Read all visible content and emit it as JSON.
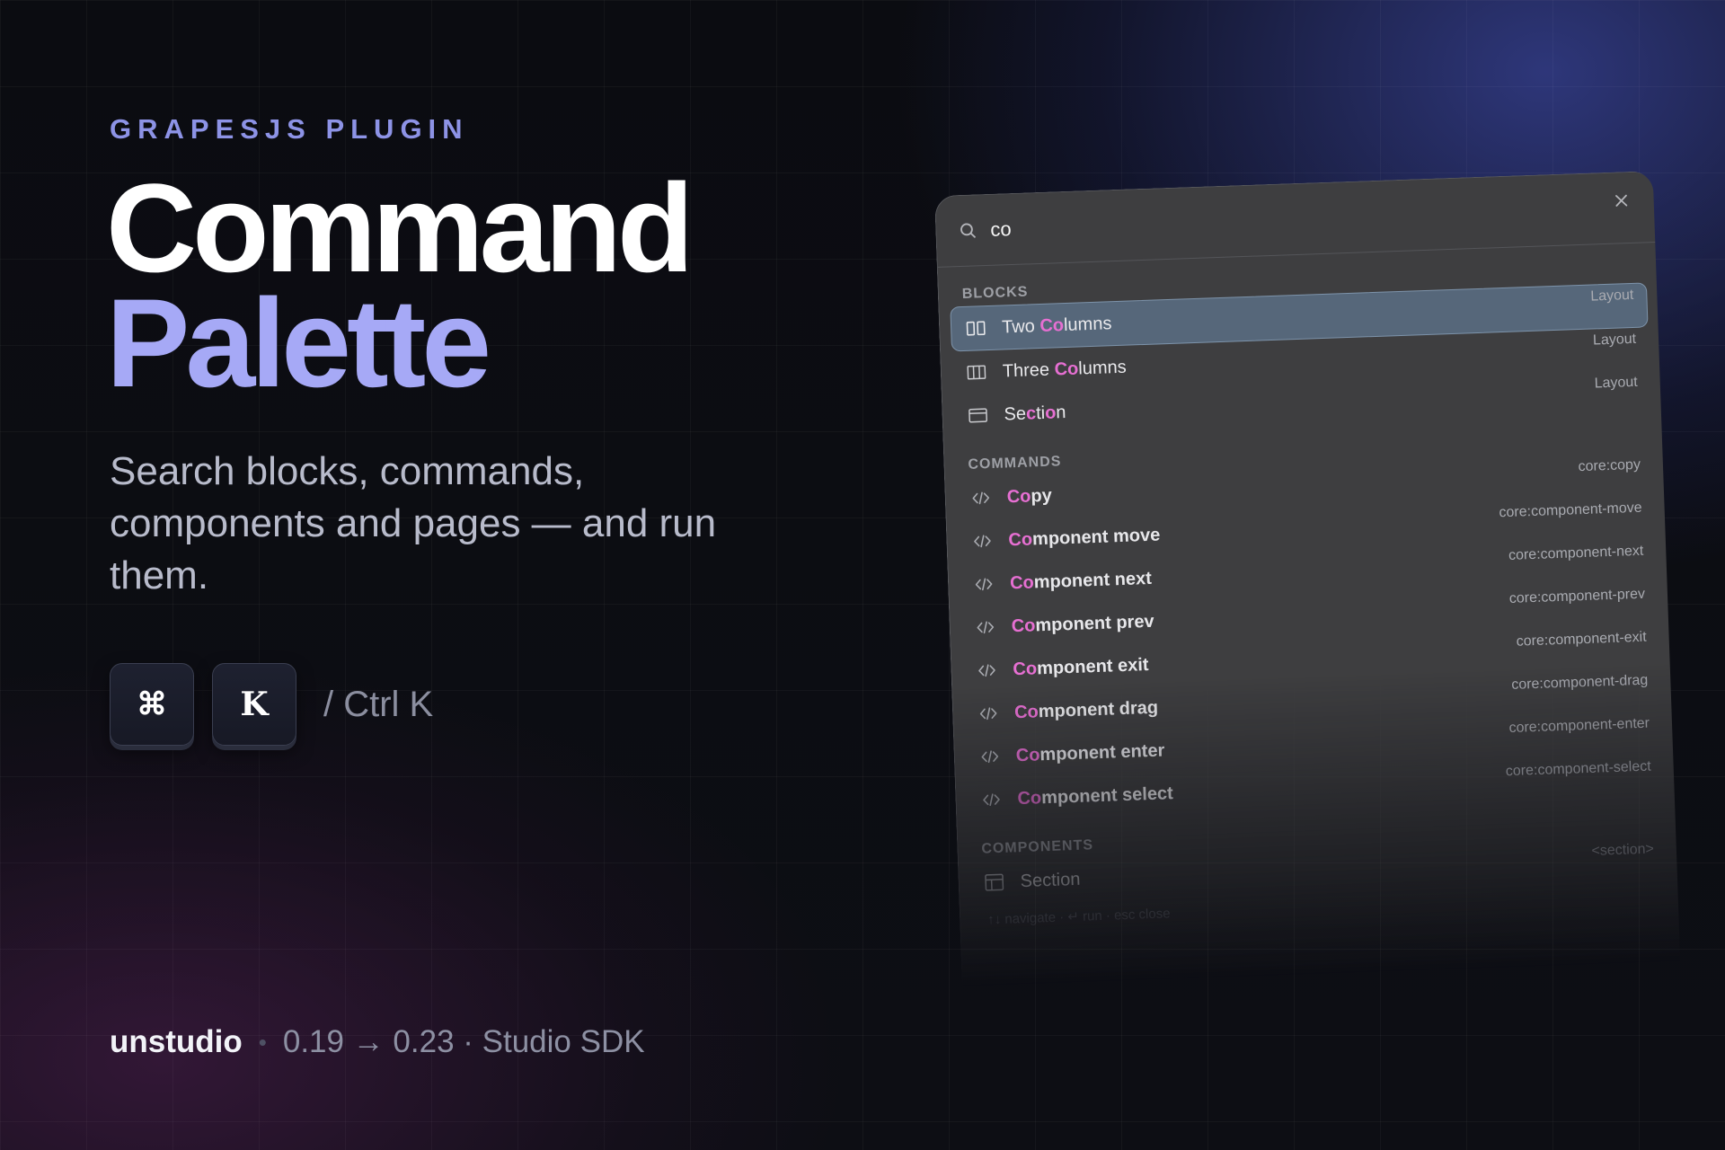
{
  "eyebrow": "GRAPESJS PLUGIN",
  "title": {
    "line1": "Command",
    "line2": "Palette"
  },
  "subtitle": "Search blocks, commands, components and pages — and run them.",
  "shortcut": {
    "key1": "⌘",
    "key2": "K",
    "alt": "/ Ctrl K"
  },
  "footer": {
    "brand": "unstudio",
    "separator": "•",
    "version": "0.19 → 0.23 · Studio SDK"
  },
  "palette": {
    "search_value": "co",
    "sections": {
      "blocks": "BLOCKS",
      "commands": "COMMANDS",
      "components": "COMPONENTS"
    },
    "blocks": [
      {
        "prefix": "Two ",
        "match": "Co",
        "rest": "lumns",
        "tag": "Layout",
        "icon": "two-columns-icon"
      },
      {
        "prefix": "Three ",
        "match": "Co",
        "rest": "lumns",
        "tag": "Layout",
        "icon": "three-columns-icon"
      },
      {
        "prefix": "Se",
        "match": "c",
        "mid": "ti",
        "match2": "o",
        "rest": "n",
        "tag": "Layout",
        "icon": "section-icon"
      }
    ],
    "commands": [
      {
        "match": "Co",
        "rest": "py",
        "tag": "core:copy"
      },
      {
        "match": "Co",
        "rest": "mponent move",
        "tag": "core:component-move"
      },
      {
        "match": "Co",
        "rest": "mponent next",
        "tag": "core:component-next"
      },
      {
        "match": "Co",
        "rest": "mponent prev",
        "tag": "core:component-prev"
      },
      {
        "match": "Co",
        "rest": "mponent exit",
        "tag": "core:component-exit"
      },
      {
        "match": "Co",
        "rest": "mponent drag",
        "tag": "core:component-drag"
      },
      {
        "match": "Co",
        "rest": "mponent enter",
        "tag": "core:component-enter"
      },
      {
        "match": "Co",
        "rest": "mponent select",
        "tag": "core:component-select"
      }
    ],
    "components": [
      {
        "label": "Section",
        "tag": "<section>"
      }
    ],
    "footer_hint": "↑↓ navigate · ↵ run · esc close"
  },
  "colors": {
    "accent": "#a6a9f6",
    "highlight": "#e66fd2",
    "active_row": "#56677a"
  }
}
